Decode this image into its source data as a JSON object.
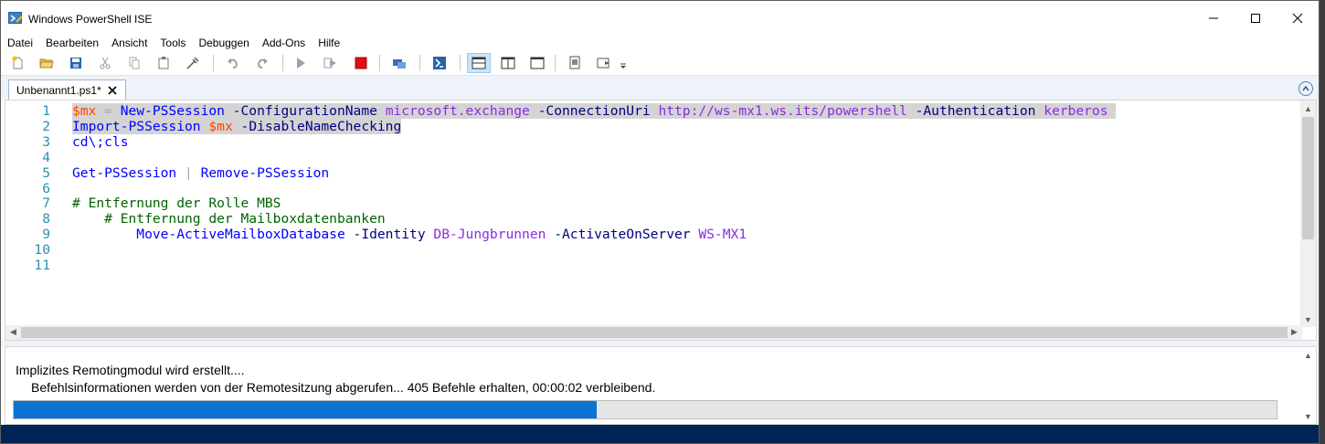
{
  "window": {
    "title": "Windows PowerShell ISE"
  },
  "menu": {
    "items": [
      "Datei",
      "Bearbeiten",
      "Ansicht",
      "Tools",
      "Debuggen",
      "Add-Ons",
      "Hilfe"
    ]
  },
  "toolbar": {
    "icons": [
      "new-file-icon",
      "open-folder-icon",
      "save-icon",
      "cut-icon",
      "copy-icon",
      "paste-icon",
      "clear-console-icon",
      "undo-icon",
      "redo-icon",
      "run-script-icon",
      "run-selection-icon",
      "stop-icon",
      "new-remote-tab-icon",
      "start-powershell-icon",
      "layout-script-top-icon",
      "layout-script-right-icon",
      "layout-script-maximized-icon",
      "show-commands-icon",
      "show-command-addon-icon"
    ]
  },
  "tab": {
    "label": "Unbenannt1.ps1*"
  },
  "editor": {
    "line_numbers": [
      "1",
      "2",
      "3",
      "4",
      "5",
      "6",
      "7",
      "8",
      "9",
      "10",
      "11"
    ],
    "lines": [
      [
        {
          "t": "$mx",
          "c": "var"
        },
        {
          "t": " = ",
          "c": "op"
        },
        {
          "t": "New-PSSession",
          "c": "cmd"
        },
        {
          "t": " -ConfigurationName ",
          "c": "param"
        },
        {
          "t": "microsoft.exchange",
          "c": "str"
        },
        {
          "t": " -ConnectionUri ",
          "c": "param"
        },
        {
          "t": "http://ws-mx1.ws.its/powershell",
          "c": "str"
        },
        {
          "t": " -Authentication ",
          "c": "param"
        },
        {
          "t": "kerberos",
          "c": "str"
        },
        {
          "t": " ",
          "c": "plain"
        }
      ],
      [
        {
          "t": "Import-PSSession",
          "c": "cmd"
        },
        {
          "t": " ",
          "c": "plain"
        },
        {
          "t": "$mx",
          "c": "var"
        },
        {
          "t": " -DisableNameChecking",
          "c": "param"
        }
      ],
      [
        {
          "t": "cd\\;cls",
          "c": "cmd"
        }
      ],
      [],
      [
        {
          "t": "Get-PSSession",
          "c": "cmd"
        },
        {
          "t": " | ",
          "c": "op"
        },
        {
          "t": "Remove-PSSession",
          "c": "cmd"
        }
      ],
      [],
      [
        {
          "t": "# Entfernung der Rolle MBS",
          "c": "comment"
        }
      ],
      [
        {
          "t": "    # Entfernung der Mailboxdatenbanken",
          "c": "comment"
        }
      ],
      [
        {
          "t": "        ",
          "c": "plain"
        },
        {
          "t": "Move-ActiveMailboxDatabase",
          "c": "cmd"
        },
        {
          "t": " -Identity ",
          "c": "param"
        },
        {
          "t": "DB-Jungbrunnen",
          "c": "str"
        },
        {
          "t": " -ActivateOnServer ",
          "c": "param"
        },
        {
          "t": "WS-MX1",
          "c": "str"
        }
      ],
      [],
      []
    ],
    "selected_lines": [
      0,
      1
    ]
  },
  "console": {
    "line1": "Implizites Remotingmodul wird erstellt....",
    "line2": "Befehlsinformationen werden von der Remotesitzung abgerufen... 405 Befehle erhalten, 00:00:02 verbleibend.",
    "progress": 0.462
  },
  "colors": {
    "selection": "#d4d4d4",
    "progress_fill": "#0b74d1",
    "statusbar": "#012456"
  }
}
